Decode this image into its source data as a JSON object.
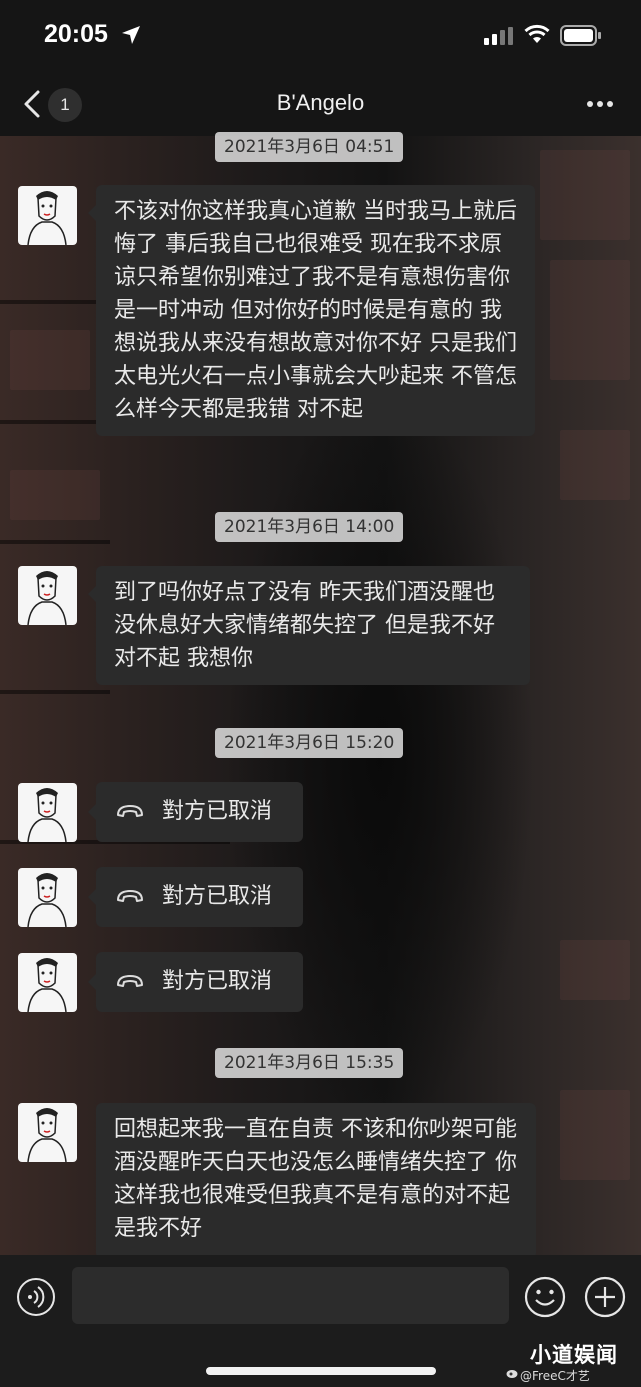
{
  "status_bar": {
    "time": "20:05"
  },
  "nav": {
    "unread_count": "1",
    "title": "B'Angelo"
  },
  "messages": [
    {
      "timestamp": "2021年3月6日 04:51",
      "text": "不该对你这样我真心道歉 当时我马上就后悔了 事后我自己也很难受 现在我不求原谅只希望你别难过了我不是有意想伤害你是一时冲动 但对你好的时候是有意的 我想说我从来没有想故意对你不好 只是我们太电光火石一点小事就会大吵起来 不管怎么样今天都是我错 对不起"
    },
    {
      "timestamp": "2021年3月6日 14:00",
      "text": "到了吗你好点了没有 昨天我们酒没醒也没休息好大家情绪都失控了 但是我不好对不起 我想你"
    },
    {
      "timestamp": "2021年3月6日 15:20",
      "calls": [
        "對方已取消",
        "對方已取消",
        "對方已取消"
      ]
    },
    {
      "timestamp": "2021年3月6日 15:35",
      "text": "回想起来我一直在自责 不该和你吵架可能酒没醒昨天白天也没怎么睡情绪失控了 你这样我也很难受但我真不是有意的对不起是我不好"
    }
  ],
  "input": {
    "placeholder": ""
  },
  "watermark": {
    "main": "小道娱闻",
    "sub": "@FreeC才艺"
  },
  "colors": {
    "bubble": "#2b2b2b",
    "timestamp_bg": "#e6e6e6",
    "bar_bg": "#151515"
  }
}
